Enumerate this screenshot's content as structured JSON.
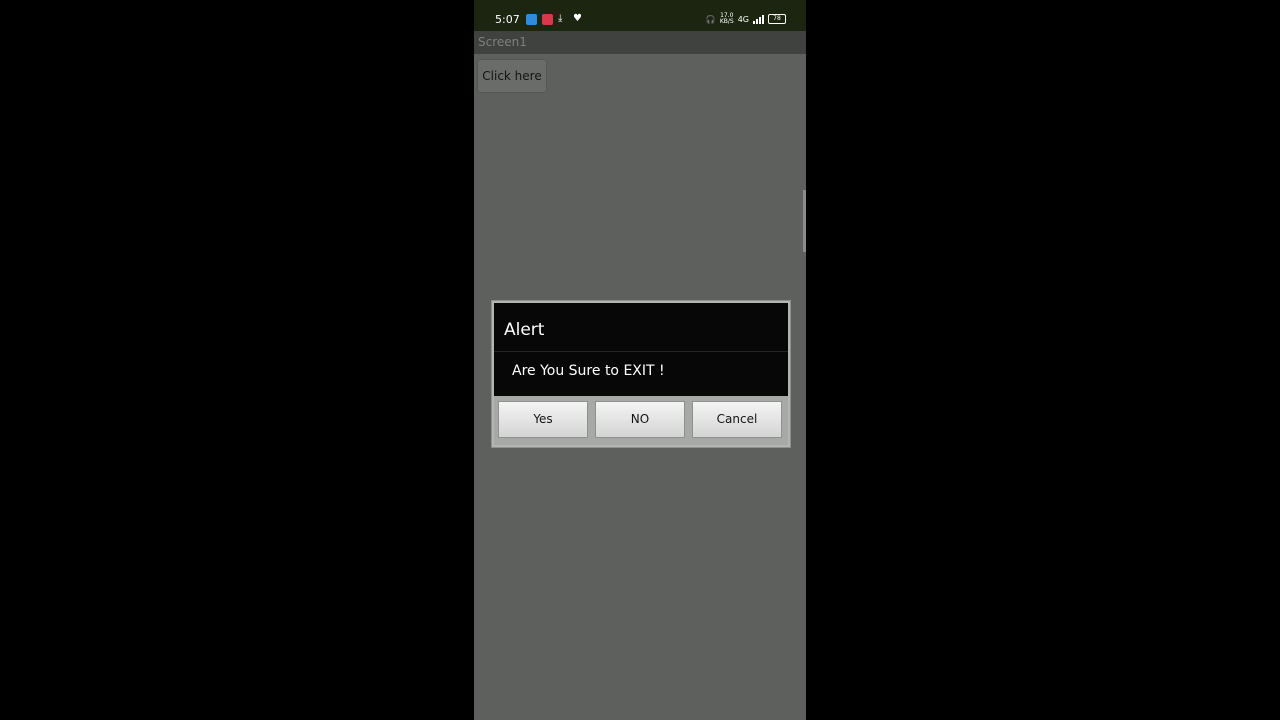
{
  "status_bar": {
    "time": "5:07",
    "icons": [
      "message-app-icon",
      "notification-app-icon",
      "download-icon",
      "heart-icon"
    ],
    "speed_value": "17.0",
    "speed_unit": "KB/S",
    "network_labels": "4G",
    "battery": "78"
  },
  "app": {
    "title": "Screen1",
    "click_button_label": "Click here"
  },
  "dialog": {
    "title": "Alert",
    "message": "Are You Sure to EXIT !",
    "buttons": {
      "yes": "Yes",
      "no": "NO",
      "cancel": "Cancel"
    }
  },
  "colors": {
    "status_bar_bg": "#1b2510",
    "screen_bg": "#5e605e",
    "dialog_header_bg": "#070707"
  }
}
